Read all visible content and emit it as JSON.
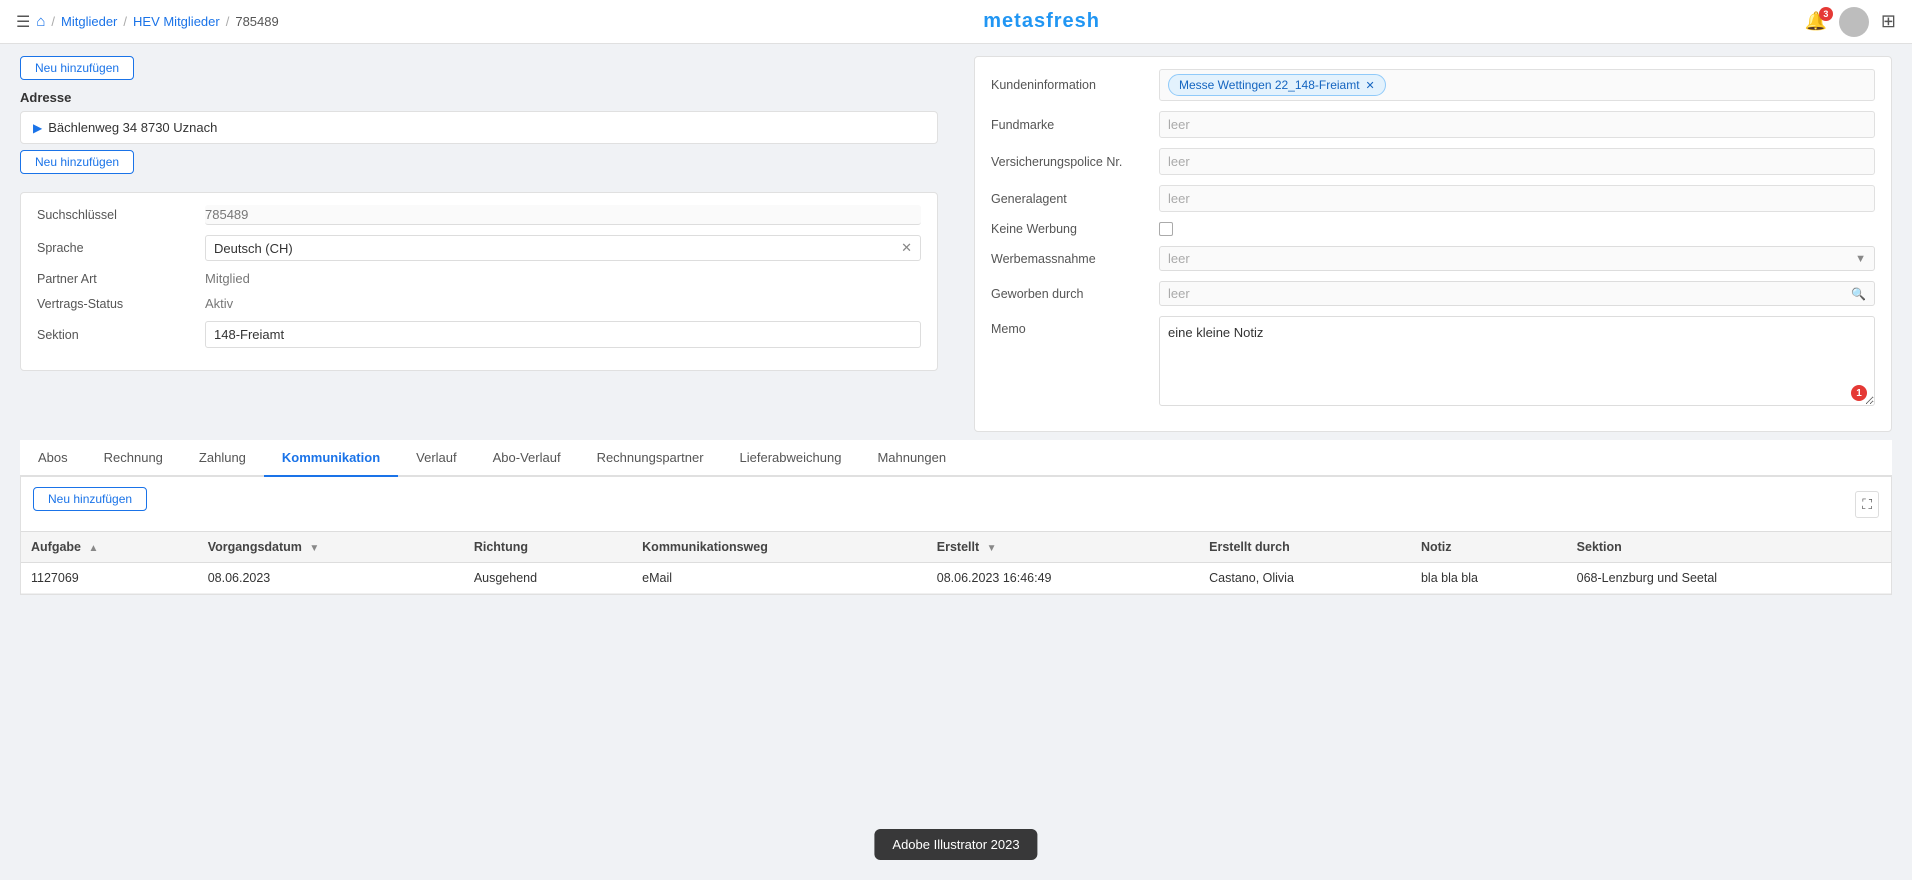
{
  "nav": {
    "menu_icon": "☰",
    "home_icon": "⌂",
    "breadcrumbs": [
      "Mitglieder",
      "HEV Mitglieder",
      "785489"
    ],
    "logo": "metasfresh",
    "notification_count": "3",
    "grid_icon": "⊞"
  },
  "address": {
    "section_label": "Adresse",
    "btn_add": "Neu hinzufügen",
    "address_line": "Bächlenweg 34 8730 Uznach"
  },
  "left_form": {
    "btn_add_top": "Neu hinzufügen",
    "fields": [
      {
        "label": "Suchschlüssel",
        "value": "785489",
        "type": "input"
      },
      {
        "label": "Sprache",
        "value": "Deutsch (CH)",
        "type": "clearable",
        "has_clear": true
      },
      {
        "label": "Partner Art",
        "value": "Mitglied",
        "type": "text_muted"
      },
      {
        "label": "Vertrags-Status",
        "value": "Aktiv",
        "type": "text_muted"
      },
      {
        "label": "Sektion",
        "value": "148-Freiamt",
        "type": "input_box"
      }
    ]
  },
  "right_form": {
    "fields": [
      {
        "label": "Kundeninformation",
        "type": "tag",
        "tag_value": "Messe Wettingen 22_148-Freiamt"
      },
      {
        "label": "Fundmarke",
        "type": "text",
        "value": "leer"
      },
      {
        "label": "Versicherungspolice Nr.",
        "type": "text",
        "value": "leer"
      },
      {
        "label": "Generalagent",
        "type": "text",
        "value": "leer"
      }
    ],
    "keine_werbung_label": "Keine Werbung",
    "werbemassnahme_label": "Werbemassnahme",
    "werbemassnahme_value": "leer",
    "geworben_durch_label": "Geworben durch",
    "geworben_durch_value": "leer",
    "memo_label": "Memo",
    "memo_value": "eine kleine Notiz",
    "memo_badge": "1"
  },
  "tabs": [
    {
      "id": "abos",
      "label": "Abos",
      "active": false
    },
    {
      "id": "rechnung",
      "label": "Rechnung",
      "active": false
    },
    {
      "id": "zahlung",
      "label": "Zahlung",
      "active": false
    },
    {
      "id": "kommunikation",
      "label": "Kommunikation",
      "active": true
    },
    {
      "id": "verlauf",
      "label": "Verlauf",
      "active": false
    },
    {
      "id": "abo-verlauf",
      "label": "Abo-Verlauf",
      "active": false
    },
    {
      "id": "rechnungspartner",
      "label": "Rechnungspartner",
      "active": false
    },
    {
      "id": "lieferabweichung",
      "label": "Lieferabweichung",
      "active": false
    },
    {
      "id": "mahnungen",
      "label": "Mahnungen",
      "active": false
    }
  ],
  "table": {
    "btn_add": "Neu hinzufügen",
    "columns": [
      {
        "id": "aufgabe",
        "label": "Aufgabe",
        "sortable": true
      },
      {
        "id": "vorgangsdatum",
        "label": "Vorgangsdatum",
        "sortable": true
      },
      {
        "id": "richtung",
        "label": "Richtung",
        "sortable": false
      },
      {
        "id": "kommunikationsweg",
        "label": "Kommunikationsweg",
        "sortable": false
      },
      {
        "id": "erstellt",
        "label": "Erstellt",
        "sortable": true
      },
      {
        "id": "erstellt_durch",
        "label": "Erstellt durch",
        "sortable": false
      },
      {
        "id": "notiz",
        "label": "Notiz",
        "sortable": false
      },
      {
        "id": "sektion",
        "label": "Sektion",
        "sortable": false
      }
    ],
    "rows": [
      {
        "aufgabe": "1127069",
        "vorgangsdatum": "08.06.2023",
        "richtung": "Ausgehend",
        "kommunikationsweg": "eMail",
        "erstellt": "08.06.2023 16:46:49",
        "erstellt_durch": "Castano, Olivia",
        "notiz": "bla bla bla",
        "sektion": "068-Lenzburg und Seetal"
      }
    ]
  },
  "tooltip": {
    "text": "Adobe Illustrator 2023"
  }
}
